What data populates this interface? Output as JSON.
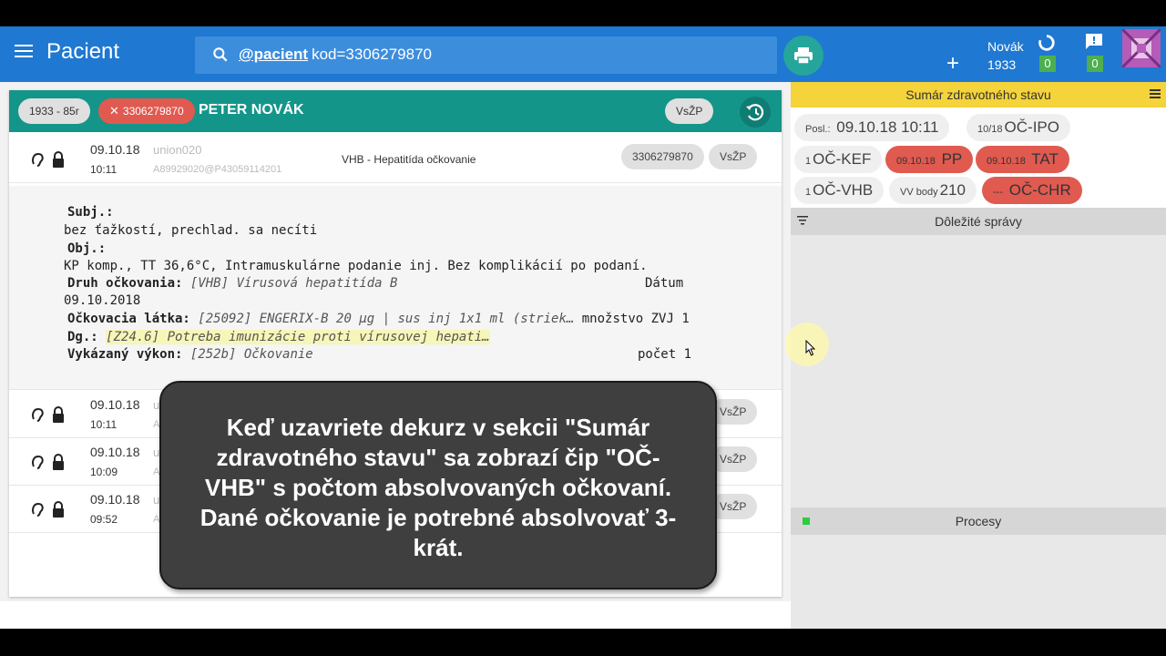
{
  "topbar": {
    "title": "Pacient",
    "search_prefix": "@pacient",
    "search_query": "kod=3306279870",
    "add_label": "+",
    "user_name": "Novák",
    "user_code": "1933",
    "sync_count": "0",
    "messages_count": "0"
  },
  "patient": {
    "age_chip": "1933 - 85r",
    "id_chip": "3306279870",
    "name": "PETER NOVÁK",
    "insurer_chip": "VsŽP"
  },
  "records": [
    {
      "date": "09.10.18",
      "time": "10:11",
      "user": "union020",
      "code": "A89929020@P43059114201",
      "description": "VHB - Hepatitída očkovanie",
      "id_chip": "3306279870",
      "insurer_chip": "VsŽP"
    },
    {
      "date": "09.10.18",
      "time": "10:11",
      "user": "u",
      "code": "A",
      "insurer_chip": "VsŽP"
    },
    {
      "date": "09.10.18",
      "time": "10:09",
      "user": "u",
      "code": "A",
      "insurer_chip": "VsŽP"
    },
    {
      "date": "09.10.18",
      "time": "09:52",
      "user": "u",
      "code": "A",
      "insurer_chip": "VsŽP"
    }
  ],
  "detail": {
    "subj_label": "Subj.:",
    "subj_text": "bez ťažkostí, prechlad. sa necíti",
    "obj_label": "Obj.:",
    "obj_text": "KP komp., TT 36,6°C, Intramuskulárne podanie inj. Bez komplikácií po podaní.",
    "druh_label": "Druh očkovania:",
    "druh_value": "[VHB] Vírusová hepatitída B",
    "datum_label": "Dátum",
    "datum_value": "09.10.2018",
    "latka_label": "Očkovacia látka:",
    "latka_value": "[25092] ENGERIX-B 20 µg | sus inj 1x1 ml (striek…",
    "mnozstvo_text": "množstvo ZVJ 1",
    "dg_label": "Dg.:",
    "dg_value": "[Z24.6] Potreba imunizácie proti vírusovej hepati…",
    "vykon_label": "Vykázaný výkon:",
    "vykon_value": "[252b] Očkovanie",
    "pocet_text": "počet 1"
  },
  "summary": {
    "header": "Sumár zdravotného stavu",
    "chips": [
      {
        "small": "Posl.:",
        "text": "09.10.18 10:11",
        "red": false
      },
      {
        "small": "10/18",
        "text": "OČ-IPO",
        "red": false
      },
      {
        "small": "1",
        "text": "OČ-KEF",
        "red": false
      },
      {
        "small": "09.10.18",
        "text": "PP",
        "red": true
      },
      {
        "small": "09.10.18",
        "text": "TAT",
        "red": true
      },
      {
        "small": "1",
        "text": "OČ-VHB",
        "red": false
      },
      {
        "small": "VV body",
        "text": "210",
        "red": false
      },
      {
        "small": "---",
        "text": "OČ-CHR",
        "red": true
      }
    ],
    "important_label": "Dôležité správy",
    "processes_label": "Procesy"
  },
  "overlay": {
    "text": "Keď uzavriete dekurz v sekcii \"Sumár zdravotného stavu\" sa zobrazí čip \"OČ-VHB\" s počtom absolvovaných očkovaní. Dané očkovanie je potrebné absolvovať 3-krát."
  },
  "colors": {
    "topbar": "#1f78d1",
    "patient_header": "#14958a",
    "summary_header": "#f5d33a",
    "red_chip": "#e05a50",
    "green_badge": "#4caf50"
  }
}
